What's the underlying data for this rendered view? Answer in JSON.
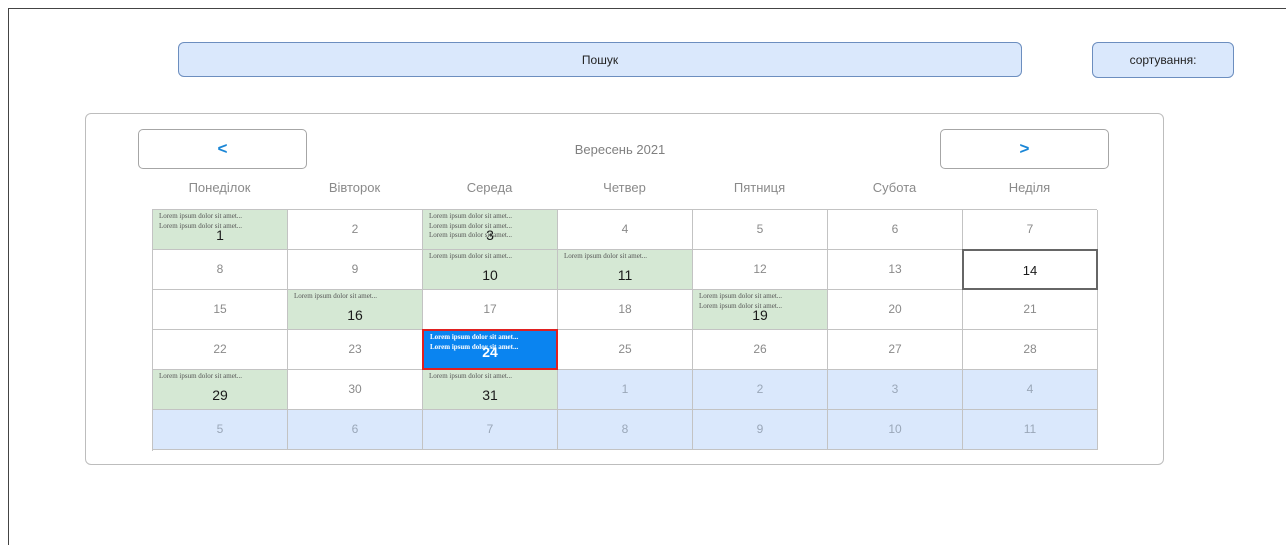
{
  "search": {
    "label": "Пошук"
  },
  "sort": {
    "label": "сортування:"
  },
  "calendar": {
    "prev_label": "<",
    "next_label": ">",
    "month_title": "Вересень 2021",
    "weekdays": [
      "Понеділок",
      "Вівторок",
      "Середа",
      "Четвер",
      "Пятниця",
      "Субота",
      "Неділя"
    ],
    "weeks": [
      [
        {
          "day": "1",
          "events": [
            "Lorem ipsum dolor sit amet...",
            "Lorem ipsum dolor sit amet..."
          ]
        },
        {
          "day": "2",
          "events": []
        },
        {
          "day": "3",
          "events": [
            "Lorem ipsum dolor sit amet...",
            "Lorem ipsum dolor sit amet...",
            "Lorem ipsum dolor sit amet..."
          ]
        },
        {
          "day": "4",
          "events": []
        },
        {
          "day": "5",
          "events": []
        },
        {
          "day": "6",
          "events": []
        },
        {
          "day": "7",
          "events": []
        }
      ],
      [
        {
          "day": "8",
          "events": []
        },
        {
          "day": "9",
          "events": []
        },
        {
          "day": "10",
          "events": [
            "Lorem ipsum dolor sit amet..."
          ]
        },
        {
          "day": "11",
          "events": [
            "Lorem ipsum dolor sit amet..."
          ]
        },
        {
          "day": "12",
          "events": []
        },
        {
          "day": "13",
          "events": []
        },
        {
          "day": "14",
          "events": [],
          "today": true
        }
      ],
      [
        {
          "day": "15",
          "events": []
        },
        {
          "day": "16",
          "events": [
            "Lorem ipsum dolor sit amet..."
          ]
        },
        {
          "day": "17",
          "events": []
        },
        {
          "day": "18",
          "events": []
        },
        {
          "day": "19",
          "events": [
            "Lorem ipsum dolor sit amet...",
            "Lorem ipsum dolor sit amet..."
          ]
        },
        {
          "day": "20",
          "events": []
        },
        {
          "day": "21",
          "events": []
        }
      ],
      [
        {
          "day": "22",
          "events": []
        },
        {
          "day": "23",
          "events": []
        },
        {
          "day": "24",
          "events": [
            "Lorem ipsum dolor sit amet...",
            "Lorem ipsum dolor sit amet..."
          ],
          "selected": true
        },
        {
          "day": "25",
          "events": []
        },
        {
          "day": "26",
          "events": []
        },
        {
          "day": "27",
          "events": []
        },
        {
          "day": "28",
          "events": []
        }
      ],
      [
        {
          "day": "29",
          "events": [
            "Lorem ipsum dolor sit amet..."
          ]
        },
        {
          "day": "30",
          "events": []
        },
        {
          "day": "31",
          "events": [
            "Lorem ipsum dolor sit amet..."
          ]
        },
        {
          "day": "1",
          "events": [],
          "other_month": true
        },
        {
          "day": "2",
          "events": [],
          "other_month": true
        },
        {
          "day": "3",
          "events": [],
          "other_month": true
        },
        {
          "day": "4",
          "events": [],
          "other_month": true
        }
      ],
      [
        {
          "day": "5",
          "events": [],
          "other_month": true
        },
        {
          "day": "6",
          "events": [],
          "other_month": true
        },
        {
          "day": "7",
          "events": [],
          "other_month": true
        },
        {
          "day": "8",
          "events": [],
          "other_month": true
        },
        {
          "day": "9",
          "events": [],
          "other_month": true
        },
        {
          "day": "10",
          "events": [],
          "other_month": true
        },
        {
          "day": "11",
          "events": [],
          "other_month": true
        }
      ]
    ]
  },
  "colors": {
    "accent_blue": "#dae8fc",
    "event_green": "#d5e8d4",
    "selected_blue": "#0a84f0",
    "selected_border": "#e02020",
    "nav_arrow": "#1a86d6"
  }
}
